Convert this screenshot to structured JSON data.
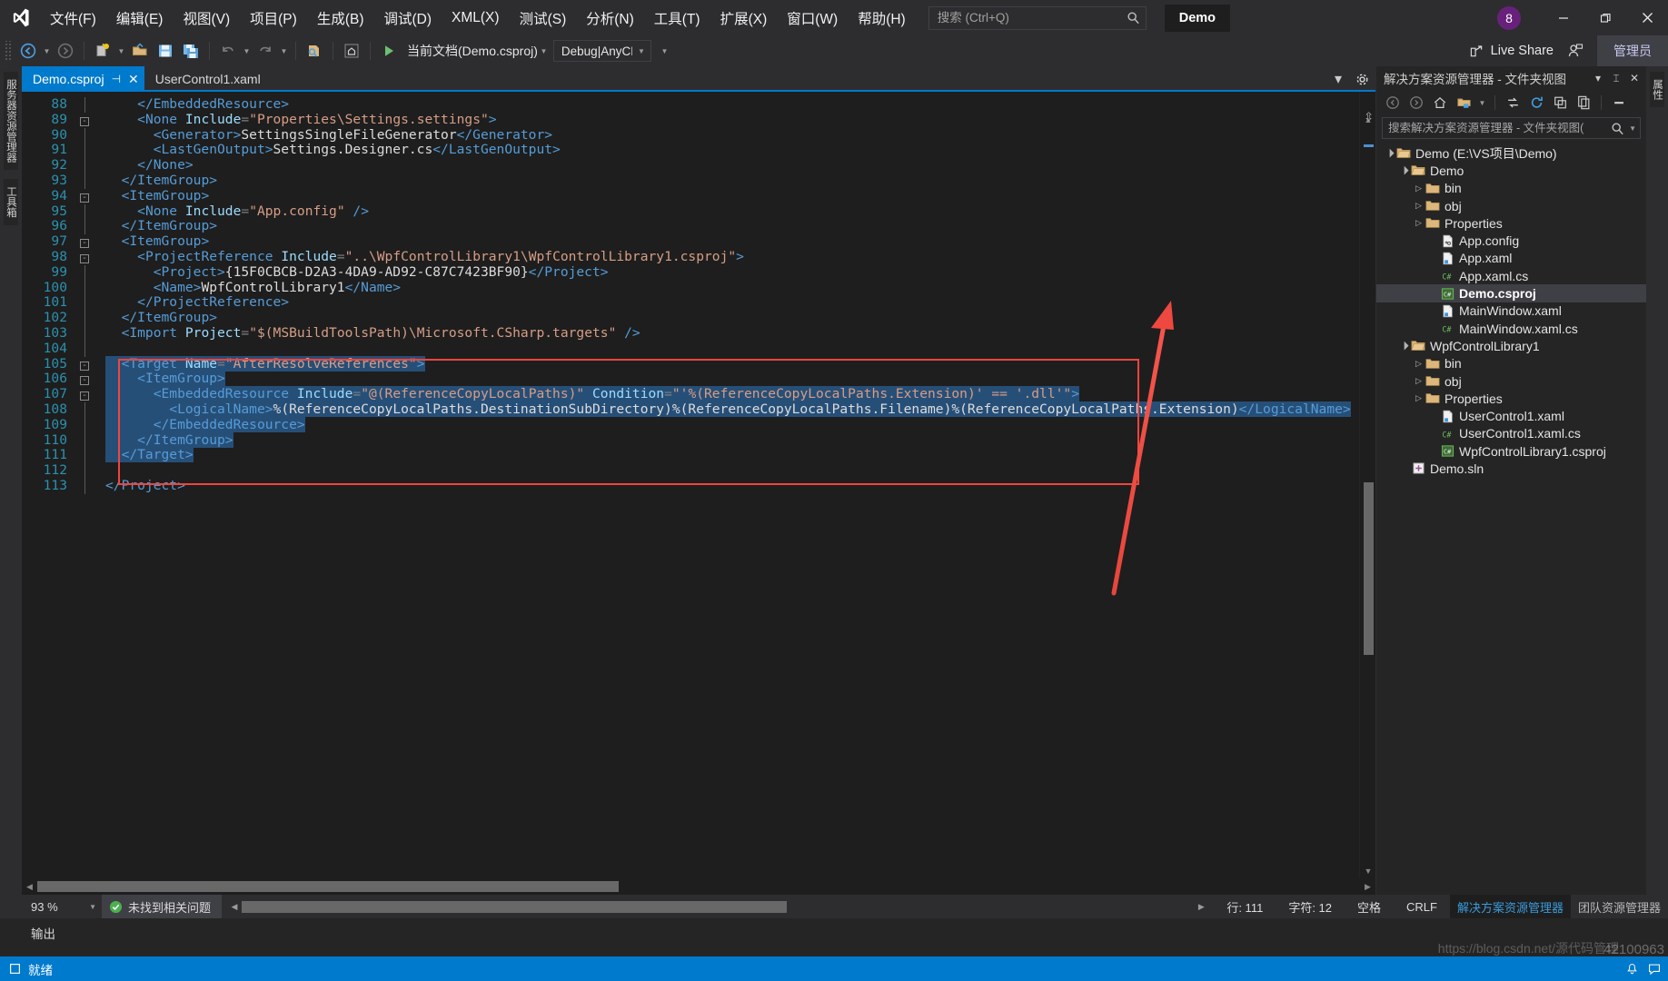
{
  "window": {
    "product_badge": "Demo",
    "notification_count": "8",
    "minimize": "—",
    "restore": "❐",
    "close": "✕"
  },
  "menu": {
    "items": [
      {
        "label": "文件(F)",
        "key": "F"
      },
      {
        "label": "编辑(E)",
        "key": "E"
      },
      {
        "label": "视图(V)",
        "key": "V"
      },
      {
        "label": "项目(P)",
        "key": "P"
      },
      {
        "label": "生成(B)",
        "key": "B"
      },
      {
        "label": "调试(D)",
        "key": "D"
      },
      {
        "label": "XML(X)",
        "key": "X"
      },
      {
        "label": "测试(S)",
        "key": "S"
      },
      {
        "label": "分析(N)",
        "key": "N"
      },
      {
        "label": "工具(T)",
        "key": "T"
      },
      {
        "label": "扩展(X)",
        "key": "X"
      },
      {
        "label": "窗口(W)",
        "key": "W"
      },
      {
        "label": "帮助(H)",
        "key": "H"
      }
    ]
  },
  "search": {
    "placeholder": "搜索 (Ctrl+Q)",
    "value": ""
  },
  "toolbar": {
    "startup_project": "当前文档(Demo.csproj)",
    "configuration": "Debug|AnyCPU",
    "run_tooltip": "启动",
    "live_share": "Live Share",
    "admin": "管理员"
  },
  "editor": {
    "tabs": [
      {
        "label": "Demo.csproj",
        "active": true,
        "pinned": true,
        "closable": true
      },
      {
        "label": "UserControl1.xaml",
        "active": false,
        "pinned": false,
        "closable": false
      }
    ],
    "zoom": "93 %",
    "issues": "未找到相关问题",
    "line_label": "行: 111",
    "col_label": "字符: 12",
    "ins_label": "空格",
    "eol_label": "CRLF",
    "lines": [
      {
        "n": "88",
        "glyph": "",
        "indent": 4,
        "sel": false,
        "parts": [
          {
            "t": "</EmbeddedResource>",
            "c": "tag"
          }
        ]
      },
      {
        "n": "89",
        "glyph": "-",
        "indent": 4,
        "sel": false,
        "parts": [
          {
            "t": "<None ",
            "c": "tag"
          },
          {
            "t": "Include",
            "c": "attr"
          },
          {
            "t": "=",
            "c": "punct"
          },
          {
            "t": "\"Properties\\Settings.settings\"",
            "c": "str"
          },
          {
            "t": ">",
            "c": "tag"
          }
        ]
      },
      {
        "n": "90",
        "glyph": "",
        "indent": 6,
        "sel": false,
        "parts": [
          {
            "t": "<Generator>",
            "c": "tag"
          },
          {
            "t": "SettingsSingleFileGenerator",
            "c": "plain"
          },
          {
            "t": "</Generator>",
            "c": "tag"
          }
        ]
      },
      {
        "n": "91",
        "glyph": "",
        "indent": 6,
        "sel": false,
        "parts": [
          {
            "t": "<LastGenOutput>",
            "c": "tag"
          },
          {
            "t": "Settings.Designer.cs",
            "c": "plain"
          },
          {
            "t": "</LastGenOutput>",
            "c": "tag"
          }
        ]
      },
      {
        "n": "92",
        "glyph": "",
        "indent": 4,
        "sel": false,
        "parts": [
          {
            "t": "</None>",
            "c": "tag"
          }
        ]
      },
      {
        "n": "93",
        "glyph": "",
        "indent": 2,
        "sel": false,
        "parts": [
          {
            "t": "</ItemGroup>",
            "c": "tag"
          }
        ]
      },
      {
        "n": "94",
        "glyph": "-",
        "indent": 2,
        "sel": false,
        "parts": [
          {
            "t": "<ItemGroup>",
            "c": "tag"
          }
        ]
      },
      {
        "n": "95",
        "glyph": "",
        "indent": 4,
        "sel": false,
        "parts": [
          {
            "t": "<None ",
            "c": "tag"
          },
          {
            "t": "Include",
            "c": "attr"
          },
          {
            "t": "=",
            "c": "punct"
          },
          {
            "t": "\"App.config\"",
            "c": "str"
          },
          {
            "t": " />",
            "c": "tag"
          }
        ]
      },
      {
        "n": "96",
        "glyph": "",
        "indent": 2,
        "sel": false,
        "parts": [
          {
            "t": "</ItemGroup>",
            "c": "tag"
          }
        ]
      },
      {
        "n": "97",
        "glyph": "-",
        "indent": 2,
        "sel": false,
        "parts": [
          {
            "t": "<ItemGroup>",
            "c": "tag"
          }
        ]
      },
      {
        "n": "98",
        "glyph": "-",
        "indent": 4,
        "sel": false,
        "parts": [
          {
            "t": "<ProjectReference ",
            "c": "tag"
          },
          {
            "t": "Include",
            "c": "attr"
          },
          {
            "t": "=",
            "c": "punct"
          },
          {
            "t": "\"..\\WpfControlLibrary1\\WpfControlLibrary1.csproj\"",
            "c": "str"
          },
          {
            "t": ">",
            "c": "tag"
          }
        ]
      },
      {
        "n": "99",
        "glyph": "",
        "indent": 6,
        "sel": false,
        "parts": [
          {
            "t": "<Project>",
            "c": "tag"
          },
          {
            "t": "{15F0CBCB-D2A3-4DA9-AD92-C87C7423BF90}",
            "c": "plain"
          },
          {
            "t": "</Project>",
            "c": "tag"
          }
        ]
      },
      {
        "n": "100",
        "glyph": "",
        "indent": 6,
        "sel": false,
        "parts": [
          {
            "t": "<Name>",
            "c": "tag"
          },
          {
            "t": "WpfControlLibrary1",
            "c": "plain"
          },
          {
            "t": "</Name>",
            "c": "tag"
          }
        ]
      },
      {
        "n": "101",
        "glyph": "",
        "indent": 4,
        "sel": false,
        "parts": [
          {
            "t": "</ProjectReference>",
            "c": "tag"
          }
        ]
      },
      {
        "n": "102",
        "glyph": "",
        "indent": 2,
        "sel": false,
        "parts": [
          {
            "t": "</ItemGroup>",
            "c": "tag"
          }
        ]
      },
      {
        "n": "103",
        "glyph": "",
        "indent": 2,
        "sel": false,
        "parts": [
          {
            "t": "<Import ",
            "c": "tag"
          },
          {
            "t": "Project",
            "c": "attr"
          },
          {
            "t": "=",
            "c": "punct"
          },
          {
            "t": "\"$(MSBuildToolsPath)\\Microsoft.CSharp.targets\"",
            "c": "str"
          },
          {
            "t": " />",
            "c": "tag"
          }
        ]
      },
      {
        "n": "104",
        "glyph": "",
        "indent": 0,
        "sel": false,
        "parts": []
      },
      {
        "n": "105",
        "glyph": "-",
        "indent": 2,
        "sel": true,
        "parts": [
          {
            "t": "<Target ",
            "c": "tag"
          },
          {
            "t": "Name",
            "c": "attr"
          },
          {
            "t": "=",
            "c": "punct"
          },
          {
            "t": "\"AfterResolveReferences\"",
            "c": "str"
          },
          {
            "t": ">",
            "c": "tag"
          }
        ]
      },
      {
        "n": "106",
        "glyph": "-",
        "indent": 4,
        "sel": true,
        "parts": [
          {
            "t": "<ItemGroup>",
            "c": "tag"
          }
        ]
      },
      {
        "n": "107",
        "glyph": "-",
        "indent": 6,
        "sel": true,
        "parts": [
          {
            "t": "<EmbeddedResource ",
            "c": "tag"
          },
          {
            "t": "Include",
            "c": "attr"
          },
          {
            "t": "=",
            "c": "punct"
          },
          {
            "t": "\"@(ReferenceCopyLocalPaths)\"",
            "c": "str"
          },
          {
            "t": " ",
            "c": "plain"
          },
          {
            "t": "Condition",
            "c": "attr"
          },
          {
            "t": "=",
            "c": "punct"
          },
          {
            "t": "\"'%(ReferenceCopyLocalPaths.Extension)' == '.dll'\"",
            "c": "str"
          },
          {
            "t": ">",
            "c": "tag"
          }
        ]
      },
      {
        "n": "108",
        "glyph": "",
        "indent": 8,
        "sel": true,
        "parts": [
          {
            "t": "<LogicalName>",
            "c": "tag"
          },
          {
            "t": "%(ReferenceCopyLocalPaths.DestinationSubDirectory)%(ReferenceCopyLocalPaths.Filename)%(ReferenceCopyLocalPaths.Extension)",
            "c": "plain"
          },
          {
            "t": "</LogicalName>",
            "c": "tag"
          }
        ]
      },
      {
        "n": "109",
        "glyph": "",
        "indent": 6,
        "sel": true,
        "parts": [
          {
            "t": "</EmbeddedResource>",
            "c": "tag"
          }
        ]
      },
      {
        "n": "110",
        "glyph": "",
        "indent": 4,
        "sel": true,
        "parts": [
          {
            "t": "</ItemGroup>",
            "c": "tag"
          }
        ]
      },
      {
        "n": "111",
        "glyph": "",
        "indent": 2,
        "sel": true,
        "parts": [
          {
            "t": "</Target>",
            "c": "tag"
          }
        ]
      },
      {
        "n": "112",
        "glyph": "",
        "indent": 0,
        "sel": false,
        "parts": []
      },
      {
        "n": "113",
        "glyph": "",
        "indent": 0,
        "sel": false,
        "parts": [
          {
            "t": "</Project>",
            "c": "tag"
          }
        ]
      }
    ]
  },
  "solution_explorer": {
    "title": "解决方案资源管理器 - 文件夹视图",
    "search_placeholder": "搜索解决方案资源管理器 - 文件夹视图(",
    "tree": [
      {
        "label": "Demo (E:\\VS项目\\Demo)",
        "depth": 0,
        "chev": "open",
        "icon": "folder-open",
        "selected": false
      },
      {
        "label": "Demo",
        "depth": 1,
        "chev": "open",
        "icon": "folder-open",
        "selected": false
      },
      {
        "label": "bin",
        "depth": 2,
        "chev": "closed",
        "icon": "folder",
        "selected": false
      },
      {
        "label": "obj",
        "depth": 2,
        "chev": "closed",
        "icon": "folder",
        "selected": false
      },
      {
        "label": "Properties",
        "depth": 2,
        "chev": "closed",
        "icon": "folder",
        "selected": false
      },
      {
        "label": "App.config",
        "depth": 3,
        "chev": "none",
        "icon": "config",
        "selected": false
      },
      {
        "label": "App.xaml",
        "depth": 3,
        "chev": "none",
        "icon": "xaml",
        "selected": false
      },
      {
        "label": "App.xaml.cs",
        "depth": 3,
        "chev": "none",
        "icon": "cs",
        "selected": false
      },
      {
        "label": "Demo.csproj",
        "depth": 3,
        "chev": "none",
        "icon": "csproj",
        "selected": true
      },
      {
        "label": "MainWindow.xaml",
        "depth": 3,
        "chev": "none",
        "icon": "xaml",
        "selected": false
      },
      {
        "label": "MainWindow.xaml.cs",
        "depth": 3,
        "chev": "none",
        "icon": "cs",
        "selected": false
      },
      {
        "label": "WpfControlLibrary1",
        "depth": 1,
        "chev": "open",
        "icon": "folder-open",
        "selected": false
      },
      {
        "label": "bin",
        "depth": 2,
        "chev": "closed",
        "icon": "folder",
        "selected": false
      },
      {
        "label": "obj",
        "depth": 2,
        "chev": "closed",
        "icon": "folder",
        "selected": false
      },
      {
        "label": "Properties",
        "depth": 2,
        "chev": "closed",
        "icon": "folder",
        "selected": false
      },
      {
        "label": "UserControl1.xaml",
        "depth": 3,
        "chev": "none",
        "icon": "xaml",
        "selected": false
      },
      {
        "label": "UserControl1.xaml.cs",
        "depth": 3,
        "chev": "none",
        "icon": "cs",
        "selected": false
      },
      {
        "label": "WpfControlLibrary1.csproj",
        "depth": 3,
        "chev": "none",
        "icon": "csproj",
        "selected": false
      },
      {
        "label": "Demo.sln",
        "depth": 1,
        "chev": "none",
        "icon": "sln",
        "selected": false
      }
    ],
    "bottom_tabs": [
      {
        "label": "解决方案资源管理器",
        "active": true
      },
      {
        "label": "团队资源管理器",
        "active": false
      }
    ]
  },
  "left_rail": {
    "tabs": [
      "服务器资源管理器",
      "工具箱"
    ]
  },
  "right_rail": {
    "tabs": [
      "属性"
    ]
  },
  "output": {
    "title": "输出"
  },
  "statusbar": {
    "state": "就绪",
    "watermark": "https://blog.csdn.net/源代码管理",
    "watermark2": "42100963"
  },
  "colors": {
    "accent": "#007acc",
    "annotation": "#f1453d",
    "selection": "#264f78",
    "chrome": "#2d2d30",
    "editor_bg": "#1e1e1e",
    "panel_bg": "#252526",
    "badge": "#68217a"
  }
}
